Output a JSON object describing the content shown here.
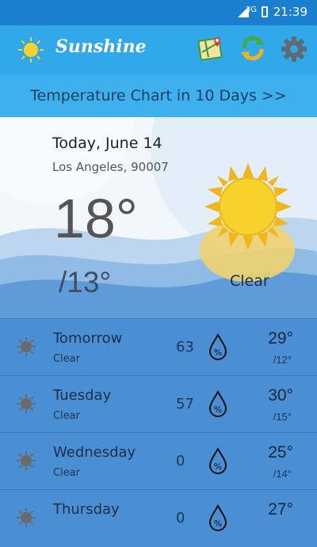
{
  "status": {
    "network": "3G",
    "time": "21:39"
  },
  "app": {
    "name": "Sunshine"
  },
  "header": {
    "icons": [
      "map-icon",
      "refresh-icon",
      "settings-gear-icon"
    ]
  },
  "chart_link": "Temperature Chart in 10 Days >>",
  "today": {
    "date": "Today, June 14",
    "location": "Los Angeles, 90007",
    "high": "18°",
    "low": "/13°",
    "condition": "Clear"
  },
  "forecast": [
    {
      "day": "Tomorrow",
      "condition": "Clear",
      "humidity": "63",
      "high": "29°",
      "low": "/12°"
    },
    {
      "day": "Tuesday",
      "condition": "Clear",
      "humidity": "57",
      "high": "30°",
      "low": "/15°"
    },
    {
      "day": "Wednesday",
      "condition": "Clear",
      "humidity": "0",
      "high": "25°",
      "low": "/14°"
    },
    {
      "day": "Thursday",
      "condition": "",
      "humidity": "0",
      "high": "27°",
      "low": ""
    }
  ],
  "colors": {
    "appbar": "#30a8ea",
    "statusbar": "#1b7fd0",
    "sun": "#f6d22a",
    "forecast_bg": "#4a8fd4"
  }
}
